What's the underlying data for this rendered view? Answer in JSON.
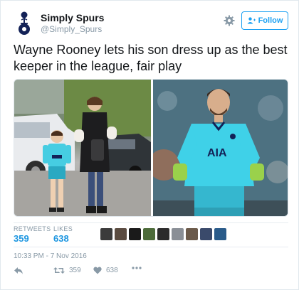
{
  "user": {
    "display_name": "Simply Spurs",
    "handle": "@Simply_Spurs",
    "avatar_icon": "tottenham-crest-icon"
  },
  "follow": {
    "label": "Follow",
    "icon": "add-user-icon"
  },
  "tweet": {
    "text": "Wayne Rooney lets his son dress up as the best keeper in the league, fair play",
    "images": [
      {
        "subject": "child-in-spurs-kit-photo"
      },
      {
        "subject": "goalkeeper-in-spurs-kit-photo"
      }
    ]
  },
  "stats": {
    "retweets_label": "RETWEETS",
    "retweets_value": "359",
    "likes_label": "LIKES",
    "likes_value": "638",
    "liker_avatar_count": 9
  },
  "timestamp": "10:33 PM - 7 Nov 2016",
  "actions": {
    "reply_icon": "reply-icon",
    "retweet_icon": "retweet-icon",
    "retweet_count": "359",
    "like_icon": "heart-icon",
    "like_count": "638",
    "more_icon": "more-icon"
  },
  "colors": {
    "accent": "#1da1f2",
    "count_blue": "#1b95e0",
    "muted": "#8899a6",
    "kit_cyan": "#3fd1e8"
  }
}
